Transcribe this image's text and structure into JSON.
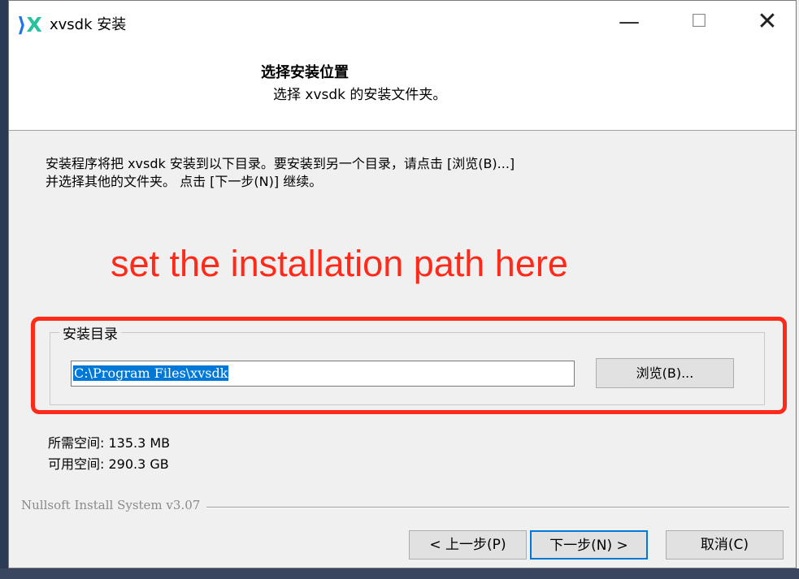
{
  "window": {
    "title": "xvsdk 安装",
    "minimize_glyph": "—",
    "maximize_glyph": "☐",
    "close_glyph": "✕"
  },
  "header": {
    "title": "选择安装位置",
    "subtitle": "选择 xvsdk 的安装文件夹。"
  },
  "description": {
    "line1": "安装程序将把 xvsdk 安装到以下目录。要安装到另一个目录，请点击 [浏览(B)...]",
    "line2": "并选择其他的文件夹。 点击 [下一步(N)] 继续。"
  },
  "annotation": {
    "text": "set the installation path here",
    "color": "#ff2a1a"
  },
  "install_dir": {
    "group_label": "安装目录",
    "path_value": "C:\\Program Files\\xvsdk",
    "browse_label": "浏览(B)..."
  },
  "space": {
    "required": "所需空间: 135.3 MB",
    "available": "可用空间: 290.3 GB"
  },
  "branding": "Nullsoft Install System v3.07",
  "buttons": {
    "back": "< 上一步(P)",
    "next": "下一步(N) >",
    "cancel": "取消(C)"
  },
  "colors": {
    "selection": "#0078d7",
    "focus_border": "#0078d7",
    "logo_blue": "#1e73e8",
    "logo_teal": "#27c2a0"
  }
}
